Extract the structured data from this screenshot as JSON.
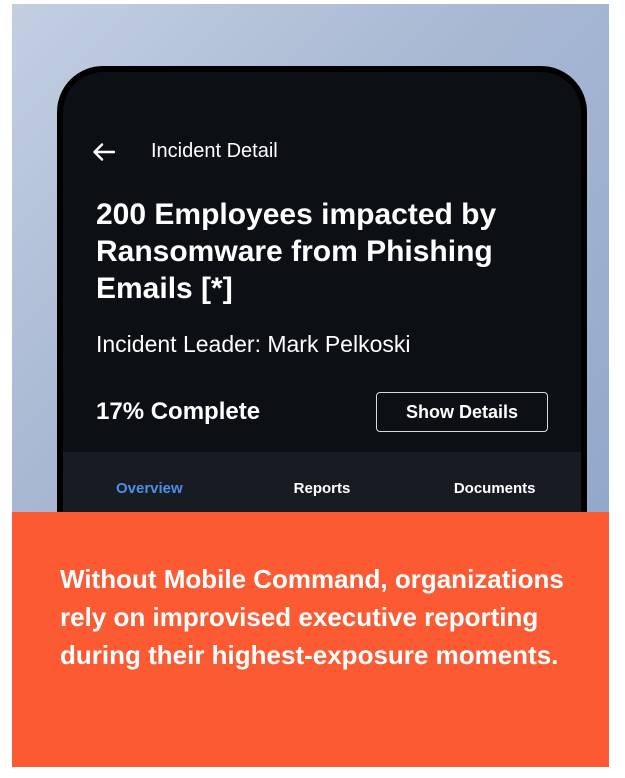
{
  "incident": {
    "header_label": "Incident Detail",
    "back_icon": "arrow-left-icon",
    "title": "200 Employees impacted by Ransomware from Phishing Emails [*]",
    "leader": "Incident Leader: Mark Pelkoski",
    "progress_text": "17% Complete",
    "progress_value": 0.17,
    "show_details_label": "Show Details"
  },
  "tabs": [
    {
      "label": "Overview",
      "active": true
    },
    {
      "label": "Reports",
      "active": false
    },
    {
      "label": "Documents",
      "active": false
    }
  ],
  "callout": {
    "text": "Without Mobile Command, organizations rely on improvised executive reporting during their highest-exposure moments."
  },
  "colors": {
    "callout_background": "#fb5a33",
    "phone_screen": "#0c0f14",
    "tab_bar": "#181c22",
    "active_tab": "#4a90e6"
  }
}
